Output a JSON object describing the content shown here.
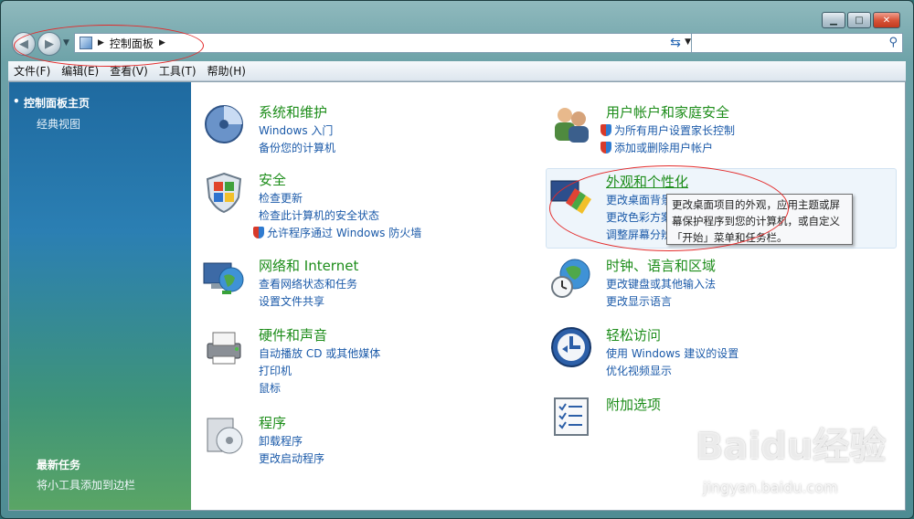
{
  "window": {
    "controls": {
      "minimize": "▁",
      "maximize": "□",
      "close": "✕"
    }
  },
  "navigation": {
    "back_icon": "◀",
    "forward_icon": "▶",
    "address_crumb": "控制面板",
    "search_placeholder": ""
  },
  "menubar": {
    "items": [
      "文件(F)",
      "编辑(E)",
      "查看(V)",
      "工具(T)",
      "帮助(H)"
    ]
  },
  "sidebar": {
    "home": "控制面板主页",
    "classic": "经典视图",
    "recent_title": "最新任务",
    "recent_item": "将小工具添加到边栏"
  },
  "categories": {
    "system": {
      "title": "系统和维护",
      "links": [
        "Windows 入门",
        "备份您的计算机"
      ]
    },
    "security": {
      "title": "安全",
      "links": [
        "检查更新",
        "检查此计算机的安全状态",
        "允许程序通过 Windows 防火墙"
      ]
    },
    "network": {
      "title": "网络和 Internet",
      "links": [
        "查看网络状态和任务",
        "设置文件共享"
      ]
    },
    "hardware": {
      "title": "硬件和声音",
      "links": [
        "自动播放 CD 或其他媒体",
        "打印机",
        "鼠标"
      ]
    },
    "programs": {
      "title": "程序",
      "links": [
        "卸载程序",
        "更改启动程序"
      ]
    },
    "users": {
      "title": "用户帐户和家庭安全",
      "links": [
        "为所有用户设置家长控制",
        "添加或删除用户帐户"
      ]
    },
    "appearance": {
      "title": "外观和个性化",
      "links": [
        "更改桌面背景",
        "更改色彩方案",
        "调整屏幕分辨率"
      ]
    },
    "clock": {
      "title": "时钟、语言和区域",
      "links": [
        "更改键盘或其他输入法",
        "更改显示语言"
      ]
    },
    "ease": {
      "title": "轻松访问",
      "links": [
        "使用 Windows 建议的设置",
        "优化视频显示"
      ]
    },
    "additional": {
      "title": "附加选项",
      "links": []
    }
  },
  "tooltip": {
    "lines": [
      "更改桌面项目的外观，应用主题或屏",
      "幕保护程序到您的计算机，或自定义",
      "「开始」菜单和任务栏。"
    ]
  },
  "watermark": {
    "main": "Baidu经验",
    "sub": "jingyan.baidu.com"
  },
  "colors": {
    "category_title": "#1d8d1a",
    "link": "#1b5aa9",
    "annotation": "#e32a2a"
  }
}
